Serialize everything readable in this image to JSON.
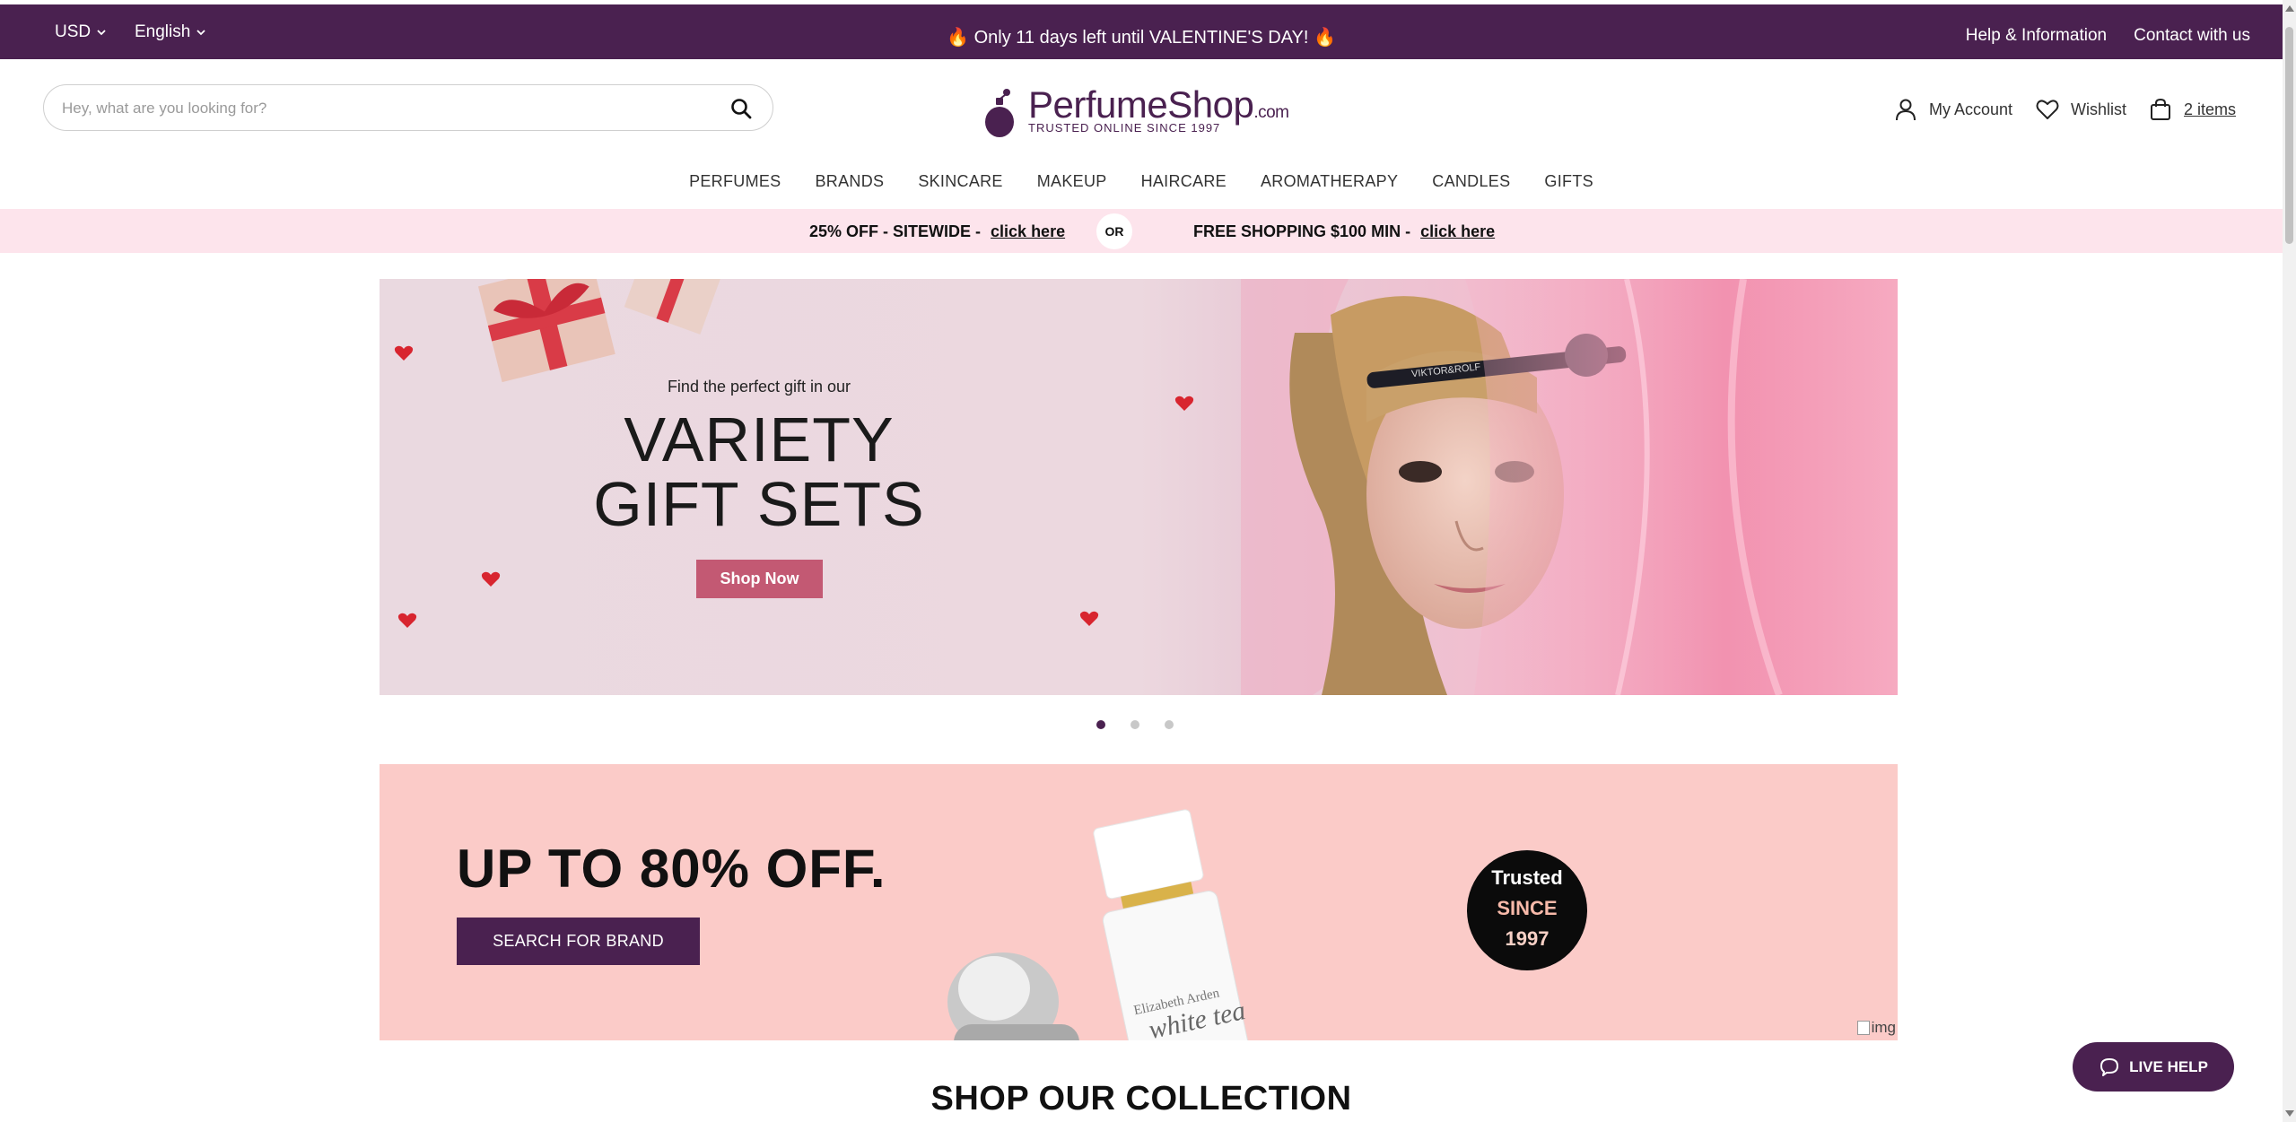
{
  "topbar": {
    "currency": "USD",
    "language": "English",
    "promo": "🔥 Only 11 days left until VALENTINE'S DAY! 🔥",
    "help_link": "Help & Information",
    "contact_link": "Contact with us"
  },
  "search": {
    "placeholder": "Hey, what are you looking for?",
    "value": ""
  },
  "logo": {
    "name": "PerfumeShop",
    "suffix": ".com",
    "tagline": "TRUSTED ONLINE SINCE 1997"
  },
  "account": {
    "my_account": "My Account",
    "wishlist": "Wishlist",
    "cart": "2 items"
  },
  "nav": [
    "PERFUMES",
    "BRANDS",
    "SKINCARE",
    "MAKEUP",
    "HAIRCARE",
    "AROMATHERAPY",
    "CANDLES",
    "GIFTS"
  ],
  "strip": {
    "offer1_text": "25% OFF - SITEWIDE -",
    "offer1_link": "click here",
    "or": "OR",
    "offer2_text": "FREE SHOPPING $100 MIN -",
    "offer2_link": "click here"
  },
  "hero": {
    "subtitle": "Find the perfect gift in our",
    "title_line1": "VARIETY",
    "title_line2": "GIFT SETS",
    "button": "Shop Now",
    "headband_text": "VIKTOR&ROLF",
    "slides": 3,
    "active_slide": 1
  },
  "sale": {
    "headline": "UP TO 80% OFF.",
    "button": "SEARCH FOR BRAND",
    "badge_line1": "Trusted",
    "badge_line2": "SINCE",
    "badge_line3": "1997",
    "bottle_brand": "Elizabeth Arden",
    "bottle_name": "white tea",
    "broken_image_alt": "img"
  },
  "collection_heading": "SHOP OUR COLLECTION",
  "live_help": "LIVE HELP",
  "colors": {
    "brand_purple": "#4a2150",
    "pink_strip": "#fde4ec",
    "hero_button": "#c35973",
    "sale_bg": "#fbcbc8"
  }
}
